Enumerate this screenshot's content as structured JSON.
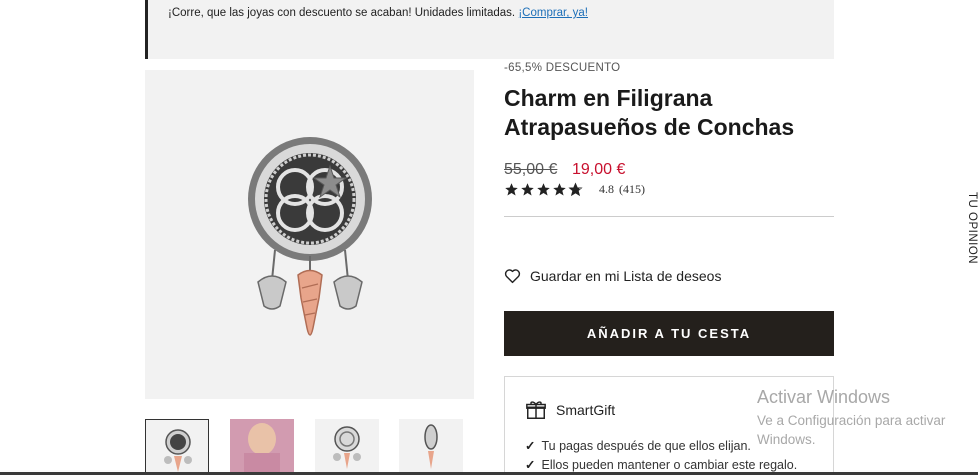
{
  "promo": {
    "text": "¡Corre, que las joyas con descuento se acaban! Unidades limitadas.",
    "link": "¡Comprar, ya!"
  },
  "product": {
    "discount_label": "-65,5% DESCUENTO",
    "title": "Charm en Filigrana Atrapasueños de Conchas",
    "price_old": "55,00 €",
    "price_new": "19,00 €",
    "rating_value": "4.8",
    "rating_count": "(415)",
    "rating_stars": 4.8
  },
  "actions": {
    "wishlist_label": "Guardar en mi Lista de deseos",
    "add_to_cart_label": "AÑADIR A TU CESTA"
  },
  "smartgift": {
    "title": "SmartGift",
    "items": [
      "Tu pagas después de que ellos elijan.",
      "Ellos pueden mantener o cambiar este regalo."
    ]
  },
  "feedback_tab": "TU OPINIÓN",
  "watermark": {
    "title": "Activar Windows",
    "subtitle": "Ve a Configuración para activar Windows."
  },
  "gallery": {
    "thumbnails": [
      "charm-front",
      "model-wearing",
      "charm-front-alt",
      "charm-side"
    ],
    "active_index": 0
  },
  "colors": {
    "accent_price": "#c8102e",
    "button_bg": "#24201c",
    "link": "#1d6fb8"
  }
}
